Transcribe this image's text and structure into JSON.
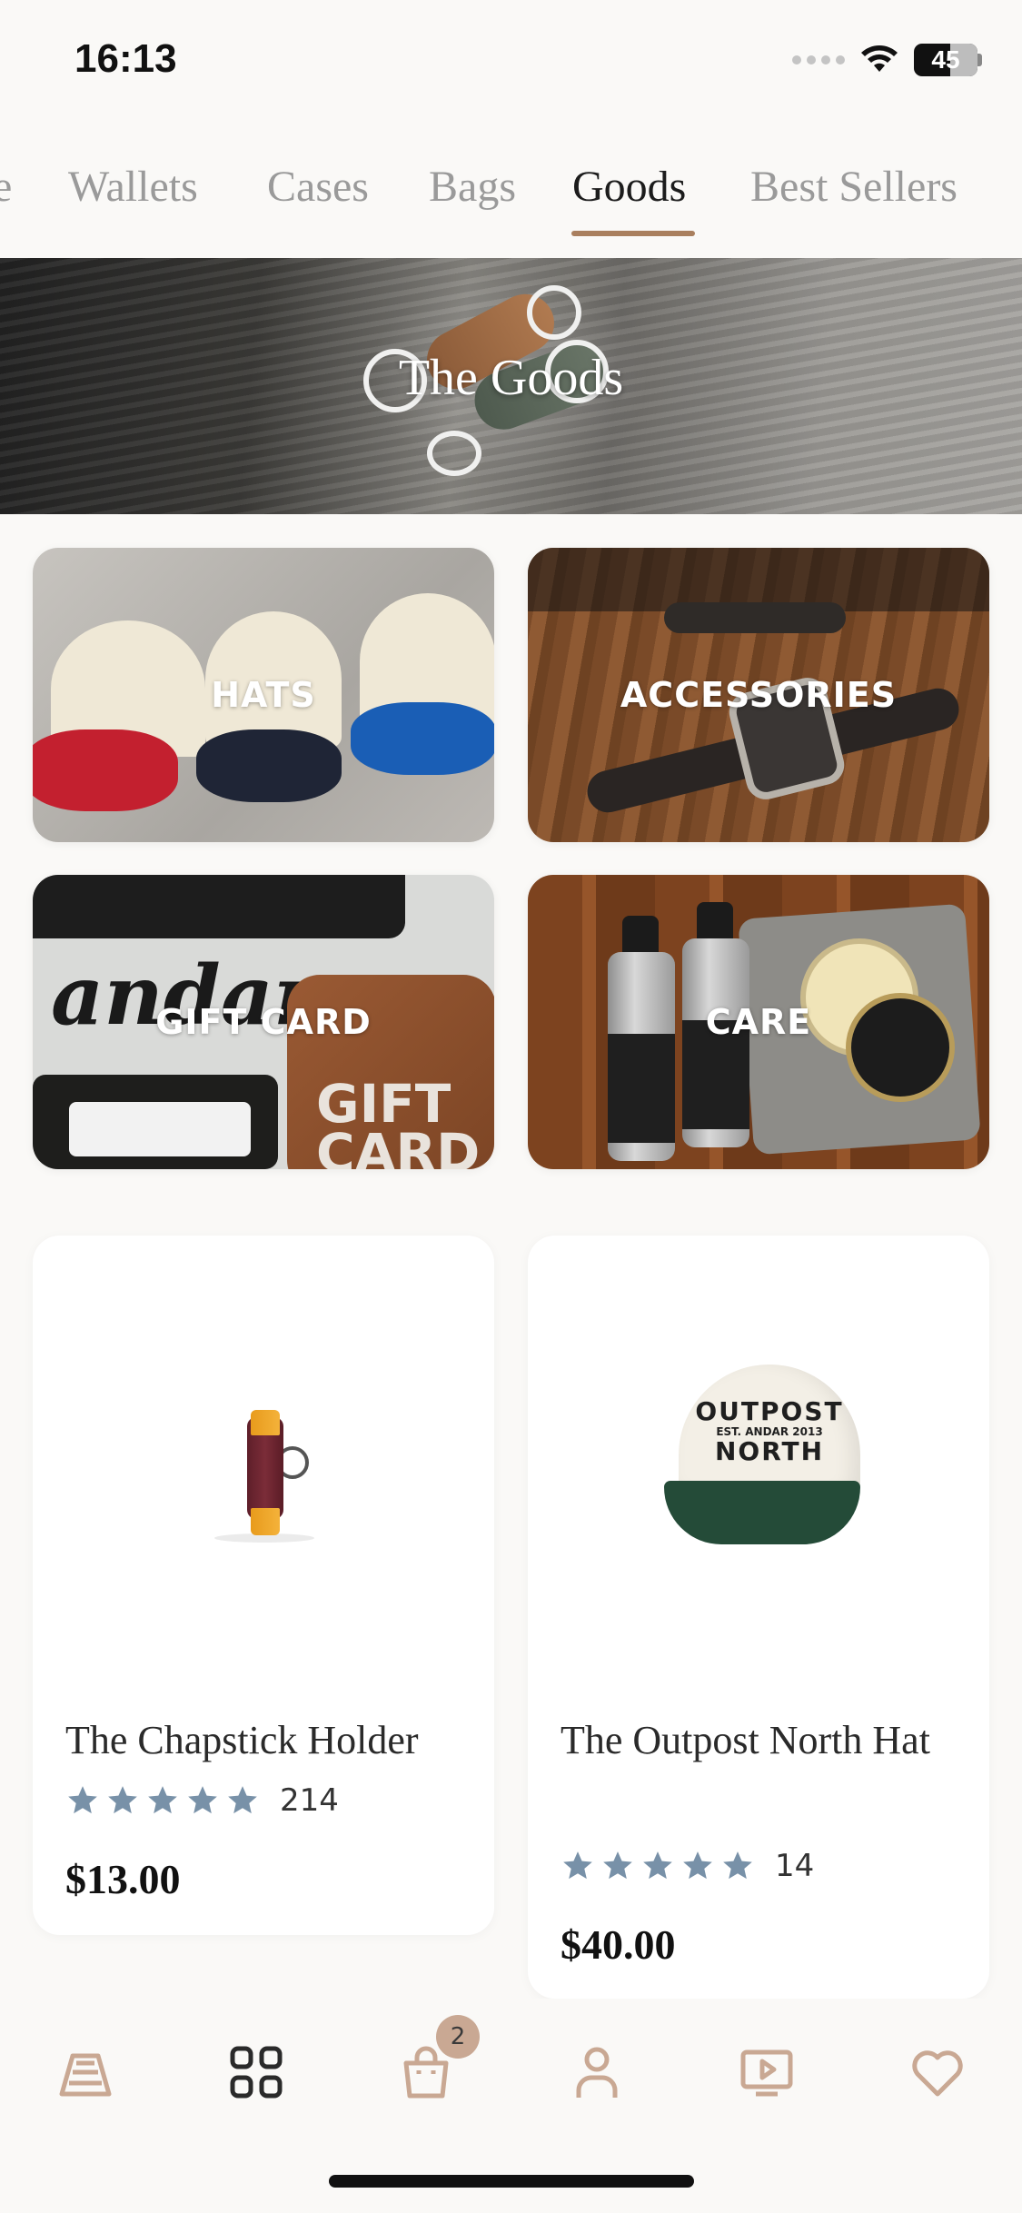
{
  "status_bar": {
    "time": "16:13",
    "battery": "45"
  },
  "tabs": [
    {
      "label": "e"
    },
    {
      "label": "Wallets"
    },
    {
      "label": "Cases"
    },
    {
      "label": "Bags"
    },
    {
      "label": "Goods",
      "active": true
    },
    {
      "label": "Best Sellers"
    }
  ],
  "hero": {
    "title": "The Goods"
  },
  "categories": [
    {
      "label": "HATS"
    },
    {
      "label": "ACCESSORIES"
    },
    {
      "label": "GIFT CARD"
    },
    {
      "label": "CARE"
    }
  ],
  "products": [
    {
      "name": "The Chapstick Holder",
      "rating": 5,
      "review_count": "214",
      "price": "$13.00"
    },
    {
      "name": "The Outpost North Hat",
      "rating": 5,
      "review_count": "14",
      "price": "$40.00"
    }
  ],
  "product_art": {
    "gift_script": "andar",
    "gift_big": "GIFT CARD",
    "hat_big_top": "OUTPOST",
    "hat_small": "EST. ANDAR 2013",
    "hat_big_bottom": "NORTH"
  },
  "tabbar": {
    "items": [
      {
        "icon": "brand-logo-icon"
      },
      {
        "icon": "grid-icon"
      },
      {
        "icon": "shopping-bag-icon"
      },
      {
        "icon": "profile-icon"
      },
      {
        "icon": "video-play-icon"
      },
      {
        "icon": "heart-icon"
      }
    ],
    "cart_badge": "2"
  },
  "colors": {
    "accent": "#a97f5e",
    "star": "#7891a8",
    "background": "#faf9f7",
    "tab_icon": "#c9a893"
  }
}
